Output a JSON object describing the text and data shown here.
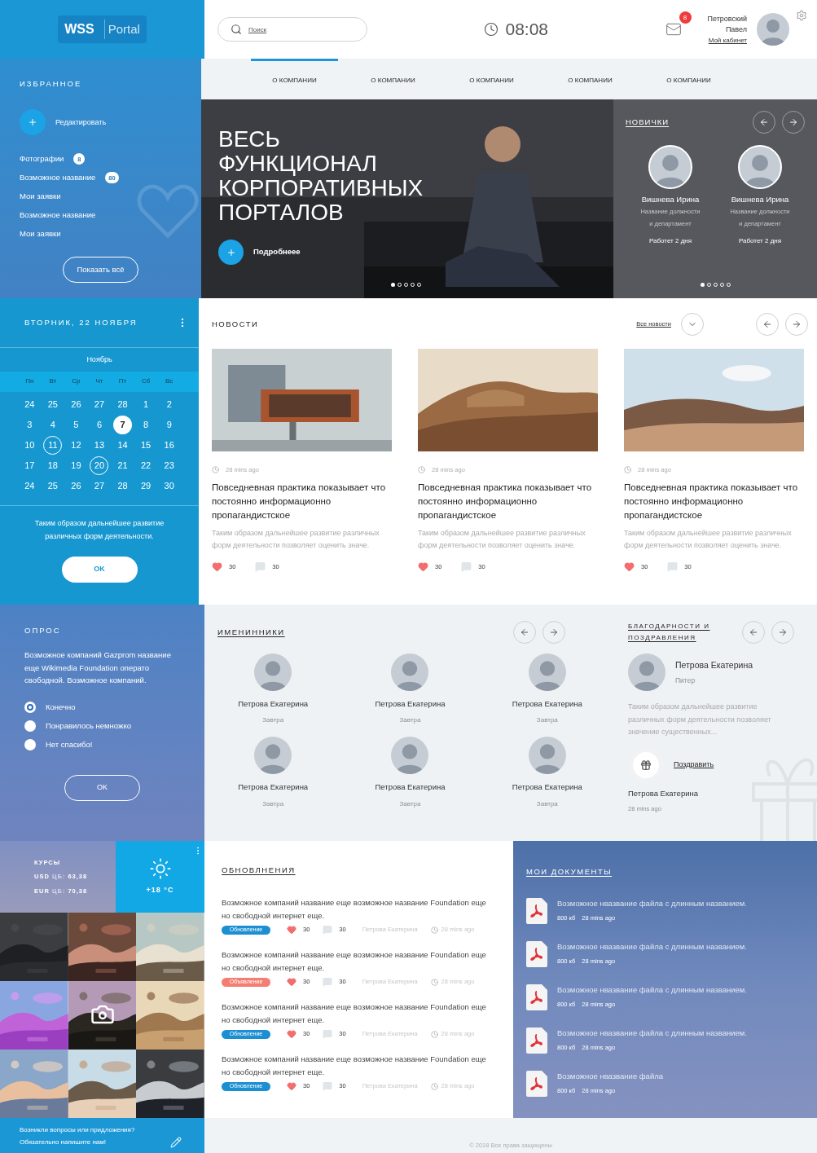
{
  "header": {
    "logo_main": "WSS",
    "logo_sub": "Portal",
    "search": {
      "placeholder": "Поиск"
    },
    "clock": "08:08",
    "mail_badge": "8",
    "user": {
      "name_line1": "Петровский",
      "name_line2": "Павел",
      "link": "Мой кабинет"
    }
  },
  "nav": [
    {
      "label": "О КОМПАНИИ",
      "selected": true
    },
    {
      "label": "О КОМПАНИИ",
      "selected": false
    },
    {
      "label": "О КОМПАНИИ",
      "selected": false
    },
    {
      "label": "О КОМПАНИИ",
      "selected": false
    },
    {
      "label": "О КОМПАНИИ",
      "selected": false
    }
  ],
  "favorites": {
    "title": "ИЗБРАННОЕ",
    "edit": "Редактировать",
    "items": [
      {
        "label": "Фотографии",
        "count": "8"
      },
      {
        "label": "Возможное название",
        "count": "80"
      },
      {
        "label": "Мои заявки"
      },
      {
        "label": "Возможное название"
      },
      {
        "label": "Мои заявки"
      }
    ],
    "show_all": "Показать всё"
  },
  "hero": {
    "title_lines": [
      "ВЕСЬ",
      "ФУНКЦИОНАЛ",
      "КОРПОРАТИВНЫХ",
      "ПОРТАЛОВ"
    ],
    "more": "Подробнеее",
    "dots": [
      {
        "selected": true
      },
      {
        "selected": false
      },
      {
        "selected": false
      },
      {
        "selected": false
      },
      {
        "selected": false
      }
    ]
  },
  "newcomers": {
    "title": "НОВИЧКИ",
    "people": [
      {
        "name": "Вишнева Ирина",
        "position": "Название должности",
        "department": "и департамент",
        "tenure": "Работет 2 дня"
      },
      {
        "name": "Вишнева Ирина",
        "position": "Название должности",
        "department": "и департамент",
        "tenure": "Работет 2 дня"
      }
    ],
    "dots": [
      {
        "selected": true
      },
      {
        "selected": false
      },
      {
        "selected": false
      },
      {
        "selected": false
      },
      {
        "selected": false
      }
    ]
  },
  "calendar": {
    "date": "ВТОРНИК, 22 НОЯБРЯ",
    "month": "Ноябрь",
    "weekdays": [
      "Пн",
      "Вт",
      "Ср",
      "Чт",
      "Пт",
      "Сб",
      "Вс"
    ],
    "weeks": [
      [
        {
          "day": "24",
          "kind": "plain"
        },
        {
          "day": "25",
          "kind": "plain"
        },
        {
          "day": "26",
          "kind": "plain"
        },
        {
          "day": "27",
          "kind": "plain"
        },
        {
          "day": "28",
          "kind": "plain"
        },
        {
          "day": "1",
          "kind": "plain"
        },
        {
          "day": "2",
          "kind": "plain"
        }
      ],
      [
        {
          "day": "3",
          "kind": "plain"
        },
        {
          "day": "4",
          "kind": "plain"
        },
        {
          "day": "5",
          "kind": "plain"
        },
        {
          "day": "6",
          "kind": "plain"
        },
        {
          "day": "7",
          "kind": "today"
        },
        {
          "day": "8",
          "kind": "plain"
        },
        {
          "day": "9",
          "kind": "plain"
        }
      ],
      [
        {
          "day": "10",
          "kind": "plain"
        },
        {
          "day": "11",
          "kind": "event"
        },
        {
          "day": "12",
          "kind": "plain"
        },
        {
          "day": "13",
          "kind": "plain"
        },
        {
          "day": "14",
          "kind": "plain"
        },
        {
          "day": "15",
          "kind": "plain"
        },
        {
          "day": "16",
          "kind": "plain"
        }
      ],
      [
        {
          "day": "17",
          "kind": "plain"
        },
        {
          "day": "18",
          "kind": "plain"
        },
        {
          "day": "19",
          "kind": "plain"
        },
        {
          "day": "20",
          "kind": "event"
        },
        {
          "day": "21",
          "kind": "plain"
        },
        {
          "day": "22",
          "kind": "plain"
        },
        {
          "day": "23",
          "kind": "plain"
        }
      ],
      [
        {
          "day": "24",
          "kind": "plain"
        },
        {
          "day": "25",
          "kind": "plain"
        },
        {
          "day": "26",
          "kind": "plain"
        },
        {
          "day": "27",
          "kind": "plain"
        },
        {
          "day": "28",
          "kind": "plain"
        },
        {
          "day": "29",
          "kind": "plain"
        },
        {
          "day": "30",
          "kind": "plain"
        }
      ]
    ],
    "note": "Таким образом дальнейшее развитие различных форм деятельности.",
    "ok": "OK"
  },
  "poll": {
    "title": "ОПРОС",
    "question": "Возможное компаний Gazprom название еще Wikimedia Foundation операто свободной. Возможное компаний.",
    "options": [
      {
        "label": "Конечно",
        "selected": true
      },
      {
        "label": "Понравилось немножко",
        "selected": false
      },
      {
        "label": "Нет спасибо!",
        "selected": false
      }
    ],
    "ok": "OK"
  },
  "rates": {
    "title": "КУРСЫ",
    "rows": [
      {
        "currency": "USD",
        "source": "ЦБ:",
        "value": "63,38"
      },
      {
        "currency": "EUR",
        "source": "ЦБ:",
        "value": "70,38"
      }
    ]
  },
  "weather": {
    "temperature": "+18 °C"
  },
  "gallery": [
    {
      "kind": "picture"
    },
    {
      "kind": "picture"
    },
    {
      "kind": "picture"
    },
    {
      "kind": "picture"
    },
    {
      "kind": "camera"
    },
    {
      "kind": "picture"
    },
    {
      "kind": "picture"
    },
    {
      "kind": "picture"
    },
    {
      "kind": "picture"
    }
  ],
  "feedback": {
    "line1": "Возникли вопросы или придложения?",
    "line2": "Обязательно напишите нам!"
  },
  "news": {
    "title": "НОВОСТИ",
    "all_link": "Все новости",
    "items": [
      {
        "time": "28 mins ago",
        "title": "Повседневная практика показывает что постоянно информационно пропагандистское",
        "text": "Таким образом дальнейшее развитие различных форм деятельности позволяет оценить значе.",
        "likes": "30",
        "comments": "30"
      },
      {
        "time": "28 mins ago",
        "title": "Повседневная практика показывает что постоянно информационно пропагандистское",
        "text": "Таким образом дальнейшее развитие различных форм деятельности позволяет оценить значе.",
        "likes": "30",
        "comments": "30"
      },
      {
        "time": "28 mins ago",
        "title": "Повседневная практика показывает что постоянно информационно пропагандистское",
        "text": "Таким образом дальнейшее развитие различных форм деятельности позволяет оценить значе.",
        "likes": "30",
        "comments": "30"
      }
    ]
  },
  "birthdays": {
    "title": "ИМЕНИННИКИ",
    "people": [
      {
        "name": "Петрова Екатерина",
        "when": "Завтра"
      },
      {
        "name": "Петрова Екатерина",
        "when": "Завтра"
      },
      {
        "name": "Петрова Екатерина",
        "when": "Завтра"
      },
      {
        "name": "Петрова Екатерина",
        "when": "Завтра"
      },
      {
        "name": "Петрова Екатерина",
        "when": "Завтра"
      },
      {
        "name": "Петрова Екатерина",
        "when": "Завтра"
      }
    ]
  },
  "thanks": {
    "title": "БЛАГОДАРНОСТИ И ПОЗДРАВЛЕНИЯ",
    "person": {
      "name": "Петрова Екатерина",
      "city": "Питер"
    },
    "text": "Таким образом дальнейшее развитие различных форм деятельности позволяет значение существенных...",
    "action": "Поздравить",
    "author": "Петрова Екатерина",
    "time": "28 mins ago"
  },
  "updates": {
    "title": "ОБНОВЛНЕНИЯ",
    "items": [
      {
        "text": "Возможное компаний название еще возможное название Foundation еще но свободной интернет еще.",
        "tag": "Обновление",
        "color": "#1b8fd2",
        "likes": "30",
        "comments": "30",
        "author": "Петрова Екатерина",
        "time": "28 mins ago"
      },
      {
        "text": "Возможное компаний название еще возможное название Foundation еще но свободной интернет еще.",
        "tag": "Объявление",
        "color": "#f47e72",
        "likes": "30",
        "comments": "30",
        "author": "Петрова Екатерина",
        "time": "28 mins ago"
      },
      {
        "text": "Возможное компаний название еще возможное название Foundation еще но свободной интернет еще.",
        "tag": "Обновление",
        "color": "#1b8fd2",
        "likes": "30",
        "comments": "30",
        "author": "Петрова Екатерина",
        "time": "28 mins ago"
      },
      {
        "text": "Возможное компаний название еще возможное название Foundation еще но свободной интернет еще.",
        "tag": "Обновление",
        "color": "#1b8fd2",
        "likes": "30",
        "comments": "30",
        "author": "Петрова Екатерина",
        "time": "28 mins ago"
      }
    ]
  },
  "documents": {
    "title": "МОИ ДОКУМЕНТЫ",
    "items": [
      {
        "name": "Возможное нвазвание файла с длинным названием.",
        "size": "800 кб",
        "time": "28 mins ago"
      },
      {
        "name": "Возможное нвазвание файла с длинным названием.",
        "size": "800 кб",
        "time": "28 mins ago"
      },
      {
        "name": "Возможное нвазвание файла с длинным названием.",
        "size": "800 кб",
        "time": "28 mins ago"
      },
      {
        "name": "Возможное нвазвание файла с длинным названием.",
        "size": "800 кб",
        "time": "28 mins ago"
      },
      {
        "name": "Возможное нвазвание файла",
        "size": "800 кб",
        "time": "28 mins ago"
      }
    ]
  },
  "footer": {
    "copyright": "© 2018 Все права защищены"
  }
}
